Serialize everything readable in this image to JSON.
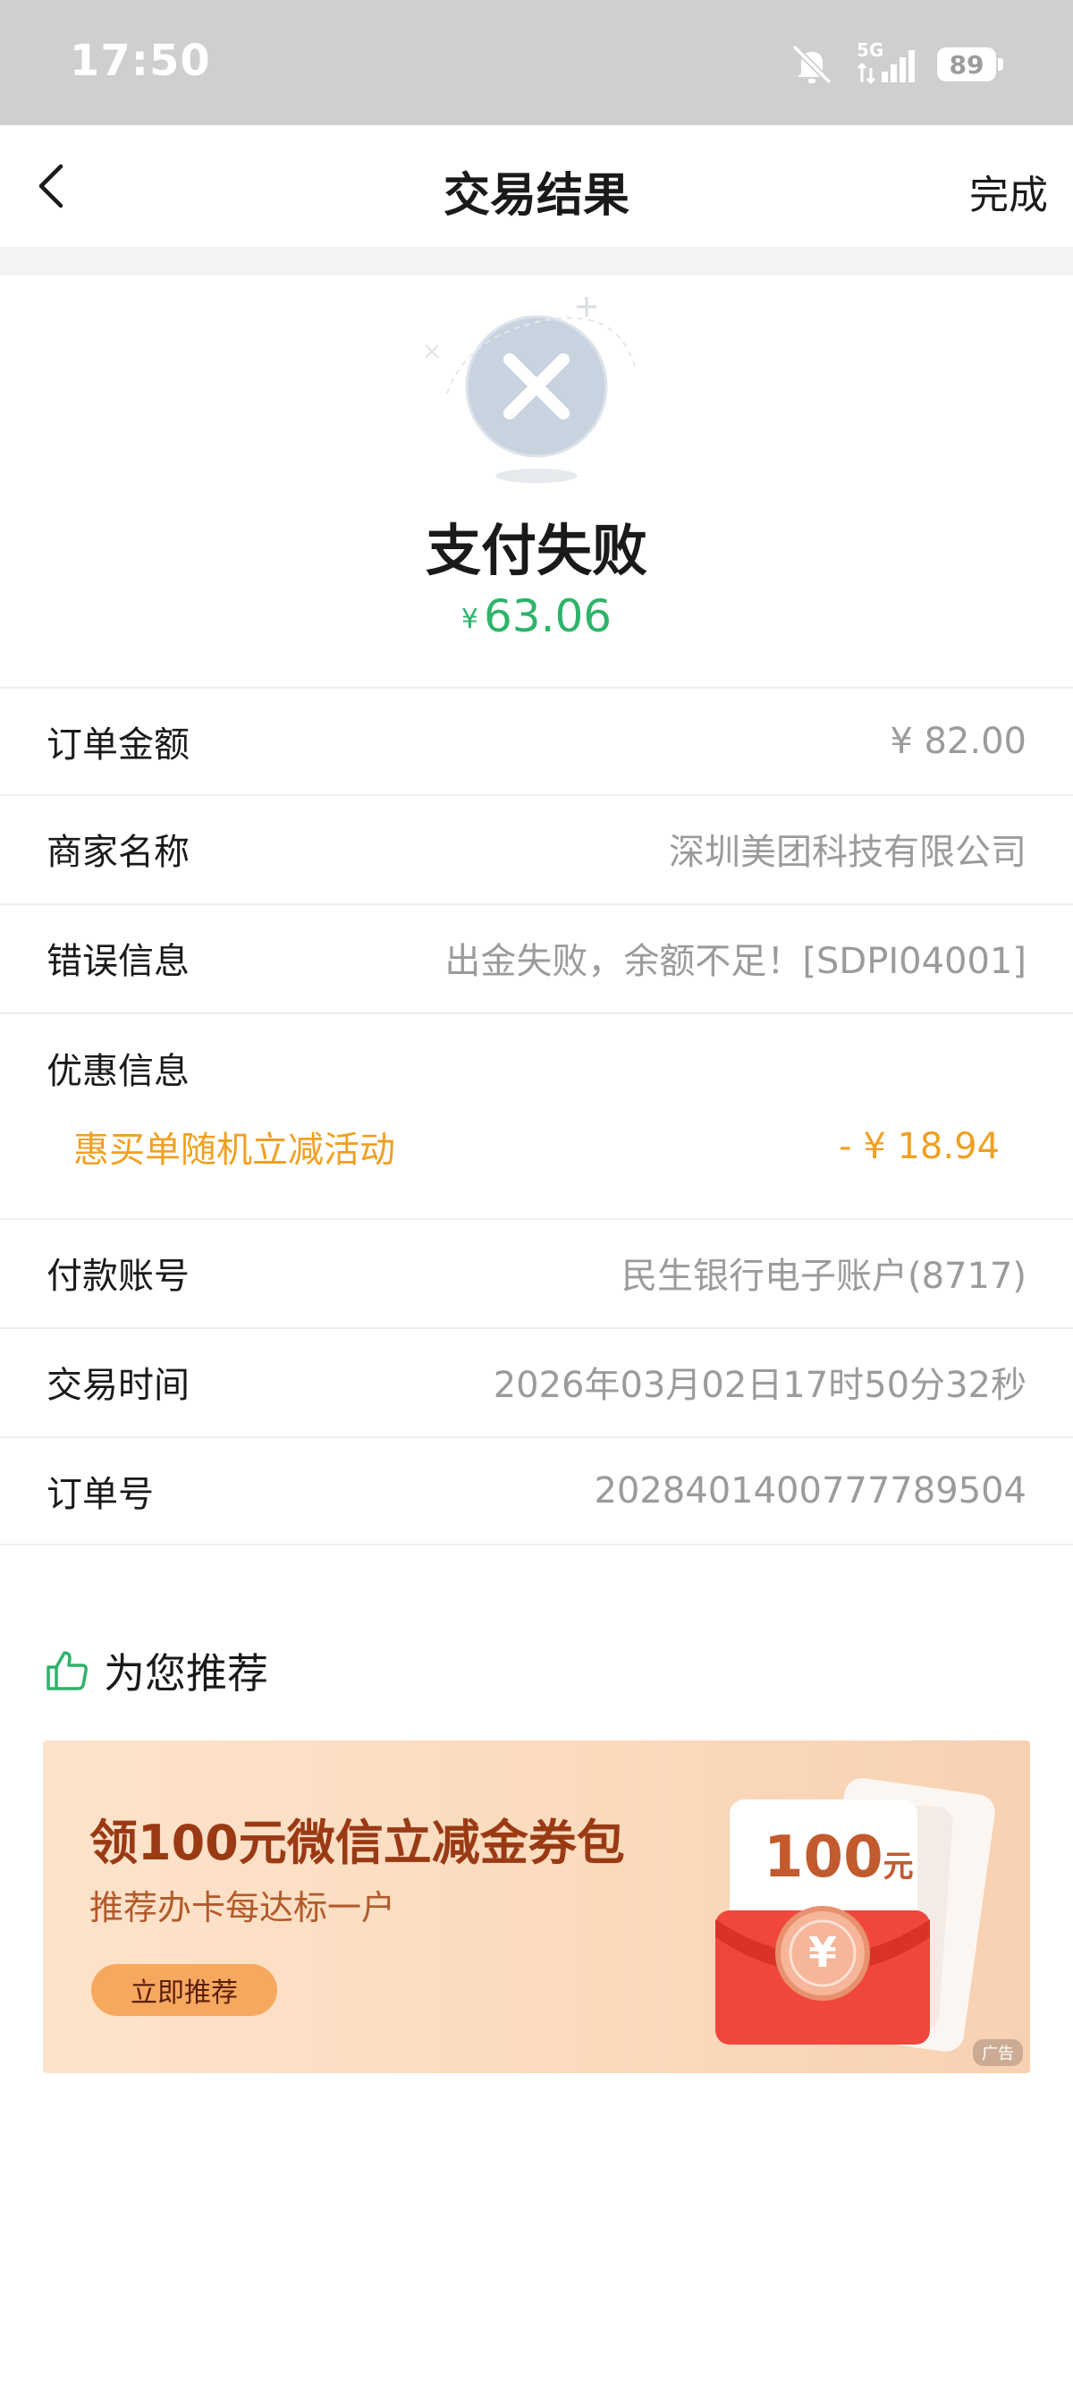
{
  "status_bar": {
    "time": "17:50",
    "network": "5G",
    "battery": "89"
  },
  "nav": {
    "title": "交易结果",
    "done_label": "完成"
  },
  "result": {
    "status_text": "支付失败",
    "currency_symbol": "¥",
    "amount": "63.06"
  },
  "details": [
    {
      "label": "订单金额",
      "value": "¥ 82.00"
    },
    {
      "label": "商家名称",
      "value": "深圳美团科技有限公司"
    },
    {
      "label": "错误信息",
      "value": "出金失败，余额不足！[SDPI04001]"
    }
  ],
  "discount": {
    "label": "优惠信息",
    "item_name": "惠买单随机立减活动",
    "item_value": "- ¥ 18.94"
  },
  "details2": [
    {
      "label": "付款账号",
      "value": "民生银行电子账户(8717)"
    },
    {
      "label": "交易时间",
      "value": "2026年03月02日17时50分32秒"
    },
    {
      "label": "订单号",
      "value": "2028401400777789504"
    }
  ],
  "recommend": {
    "title": "为您推荐",
    "banner": {
      "headline": "领100元微信立减金券包",
      "subline": "推荐办卡每达标一户",
      "button": "立即推荐",
      "art_amount": "100",
      "art_unit": "元",
      "art_coin": "¥",
      "ad_tag": "广告"
    }
  },
  "colors": {
    "accent_green": "#2fb36a",
    "discount_orange": "#f0a022",
    "banner_text": "#9a3a14"
  }
}
